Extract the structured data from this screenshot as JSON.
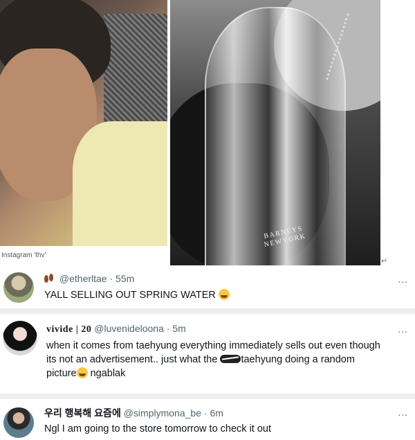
{
  "images": {
    "left_caption": "Instagram 'thv'",
    "bottle_label_line1": "BARNEYS",
    "bottle_label_line2": "NEWYORK"
  },
  "tweets": [
    {
      "display_name": "",
      "handle": "@etherltae",
      "time": "55m",
      "text": "YALL SELLING OUT SPRING WATER",
      "more": "..."
    },
    {
      "display_name": "vivide | 20",
      "handle": "@luvenideloona",
      "time": "5m",
      "text_line1": "when it comes from taehyung everything immediately sells out even though",
      "text_line2": "its not an advertisement.. just what the",
      "text_line2b": "taehyung doing a random",
      "text_line3a": "picture",
      "text_line3b": "ngablak",
      "more": "..."
    },
    {
      "display_name": "우리 행복해 요즘에",
      "handle": "@simplymona_be",
      "time": "6m",
      "text": "Ngl I am going to the store tomorrow to check it out",
      "more": "..."
    }
  ],
  "separator": "·"
}
